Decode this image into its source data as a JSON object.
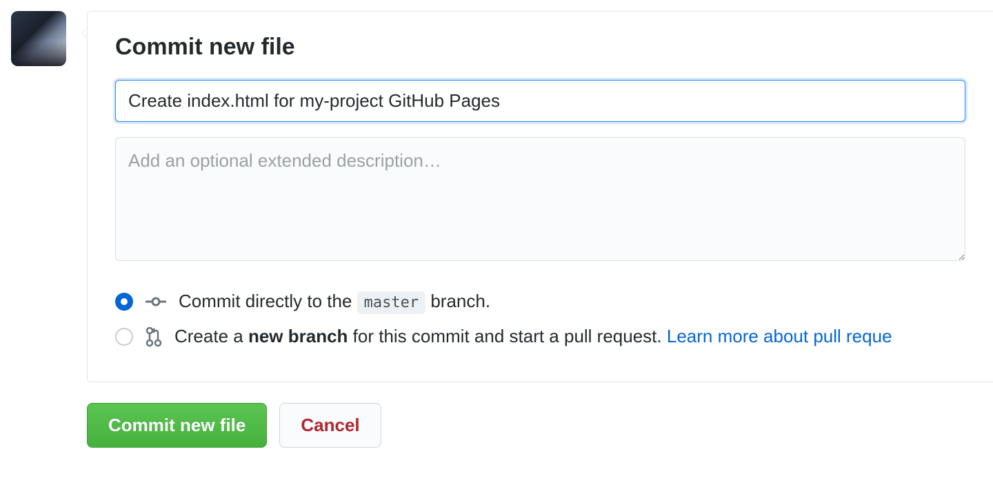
{
  "commit_form": {
    "title": "Commit new file",
    "summary_value": "Create index.html for my-project GitHub Pages",
    "description_placeholder": "Add an optional extended description…",
    "options": {
      "direct": {
        "prefix": "Commit directly to the ",
        "branch": "master",
        "suffix": " branch."
      },
      "new_branch": {
        "prefix": "Create a ",
        "bold": "new branch",
        "suffix": " for this commit and start a pull request. ",
        "link": "Learn more about pull reque"
      }
    },
    "actions": {
      "commit": "Commit new file",
      "cancel": "Cancel"
    }
  }
}
